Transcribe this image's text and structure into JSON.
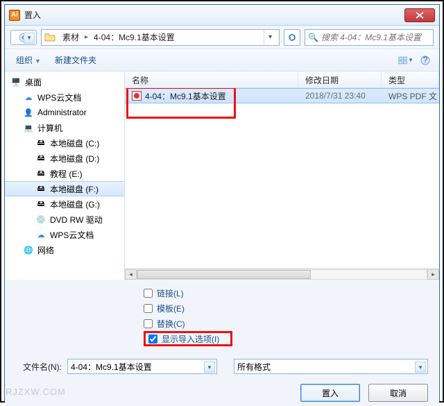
{
  "title": "置入",
  "path": {
    "crumb1": "素材",
    "crumb2": "4-04：Mc9.1基本设置"
  },
  "search": {
    "placeholder": "搜索 4-04：Mc9.1基本设置"
  },
  "toolbar": {
    "organize": "组织",
    "new_folder": "新建文件夹"
  },
  "columns": {
    "name": "名称",
    "date": "修改日期",
    "type": "类型"
  },
  "tree": {
    "desktop": "桌面",
    "wps1": "WPS云文档",
    "admin": "Administrator",
    "computer": "计算机",
    "disk_c": "本地磁盘 (C:)",
    "disk_d": "本地磁盘 (D:)",
    "disk_e": "教程 (E:)",
    "disk_f": "本地磁盘 (F:)",
    "disk_g": "本地磁盘 (G:)",
    "dvd": "DVD RW 驱动",
    "wps2": "WPS云文档",
    "network": "网络"
  },
  "rows": [
    {
      "name": "4-04：Mc9.1基本设置",
      "date": "2018/7/31 23:40",
      "type": "WPS PDF 文"
    }
  ],
  "options": {
    "link": "链接(L)",
    "template": "模板(E)",
    "replace": "替换(C)",
    "show_import": "显示导入选项(I)",
    "link_checked": false,
    "template_checked": false,
    "replace_checked": false,
    "show_import_checked": true
  },
  "filename": {
    "label": "文件名(N):",
    "value": "4-04：Mc9.1基本设置"
  },
  "filetype": {
    "value": "所有格式"
  },
  "buttons": {
    "ok": "置入",
    "cancel": "取消"
  },
  "watermark": "RJZXW.COM"
}
